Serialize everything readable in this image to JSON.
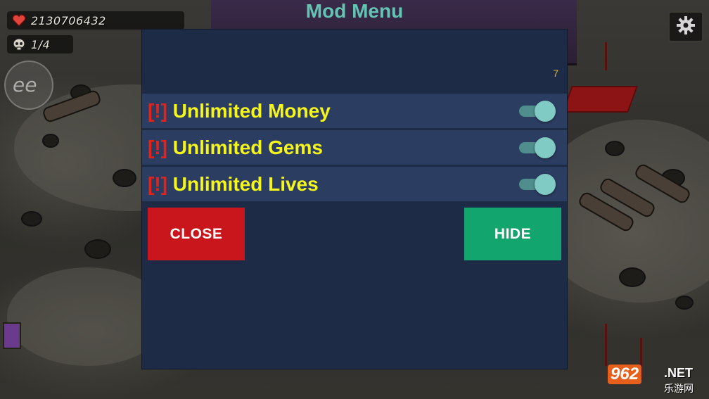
{
  "hud": {
    "money_value": "2130706432",
    "lives_value": "1/4"
  },
  "mod_menu": {
    "title": "Mod Menu",
    "subtitle": "7",
    "items": [
      {
        "warn": "[!]",
        "label": "Unlimited Money",
        "enabled": true
      },
      {
        "warn": "[!]",
        "label": "Unlimited Gems",
        "enabled": true
      },
      {
        "warn": "[!]",
        "label": "Unlimited Lives",
        "enabled": true
      }
    ],
    "close_label": "CLOSE",
    "hide_label": "HIDE"
  },
  "watermark": {
    "number": "962",
    "domain": ".NET",
    "chinese": "乐游网"
  },
  "colors": {
    "panel_bg": "#1d2b46",
    "row_bg": "#2c3d62",
    "title": "#64c4b3",
    "item_text": "#f5f51c",
    "warn": "#e2231a",
    "close_button": "#c9161d",
    "hide_button": "#12a56d",
    "toggle_on": "#80cbc4"
  },
  "icons": {
    "money": "heart-icon",
    "lives": "skull-icon",
    "settings": "gear-icon",
    "side": "ee-icon"
  }
}
